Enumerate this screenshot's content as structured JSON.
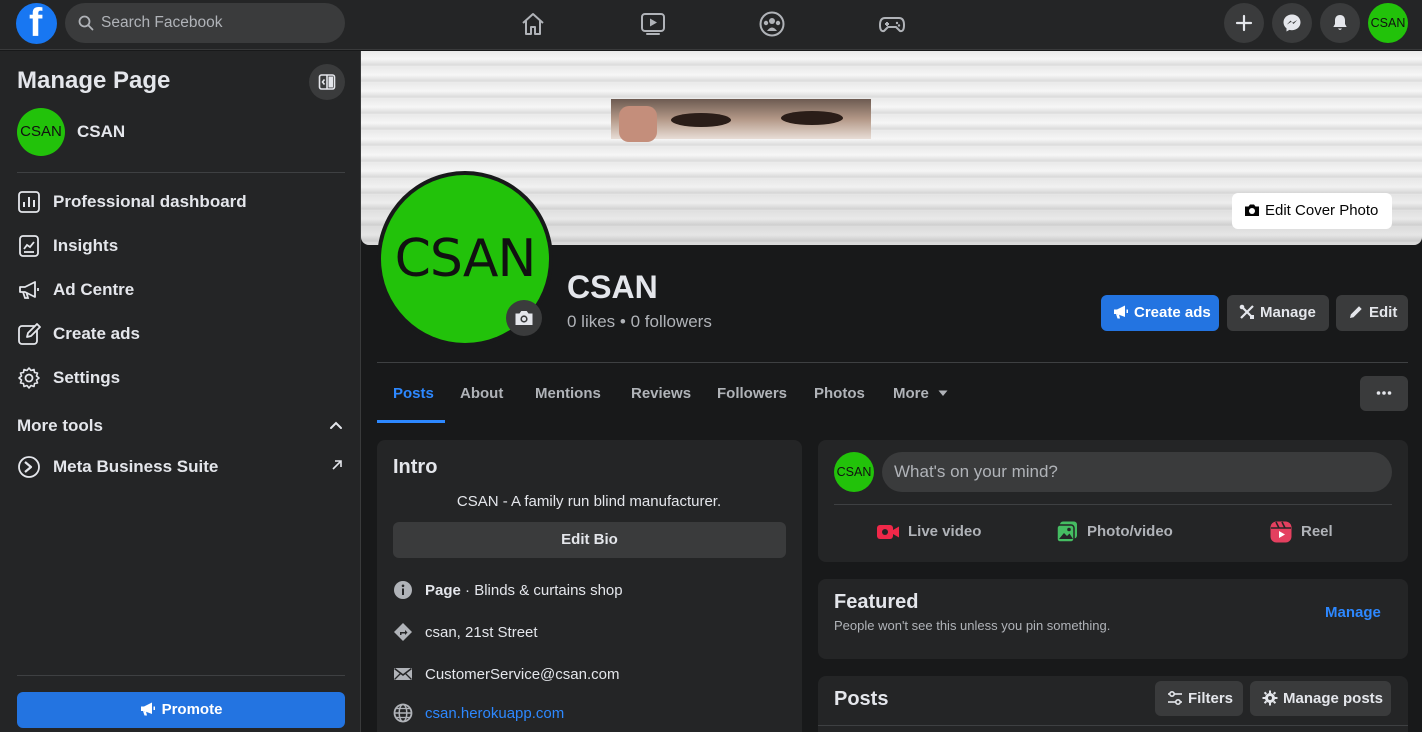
{
  "topbar": {
    "logo": "f",
    "search_placeholder": "Search Facebook",
    "nav_icons": [
      "home-icon",
      "watch-icon",
      "groups-icon",
      "gaming-icon"
    ],
    "right_icons": [
      "plus-icon",
      "messenger-icon",
      "notifications-icon"
    ],
    "avatar_text": "CSAN"
  },
  "sidebar": {
    "title": "Manage Page",
    "page_avatar": "CSAN",
    "page_name": "CSAN",
    "items": [
      {
        "label": "Professional dashboard",
        "icon": "dashboard-icon"
      },
      {
        "label": "Insights",
        "icon": "insights-icon"
      },
      {
        "label": "Ad Centre",
        "icon": "megaphone-icon"
      },
      {
        "label": "Create ads",
        "icon": "edit-icon"
      },
      {
        "label": "Settings",
        "icon": "gear-icon"
      }
    ],
    "more_tools": "More tools",
    "meta_suite": "Meta Business Suite",
    "promote": "Promote"
  },
  "header": {
    "edit_cover": "Edit Cover Photo",
    "profile_pic_text": "CSAN",
    "page_name": "CSAN",
    "stats": "0 likes • 0 followers",
    "create_ads": "Create ads",
    "manage": "Manage",
    "edit": "Edit"
  },
  "tabs": [
    {
      "label": "Posts",
      "active": true
    },
    {
      "label": "About"
    },
    {
      "label": "Mentions"
    },
    {
      "label": "Reviews"
    },
    {
      "label": "Followers"
    },
    {
      "label": "Photos"
    },
    {
      "label": "More"
    }
  ],
  "intro": {
    "title": "Intro",
    "bio": "CSAN - A family run blind manufacturer.",
    "edit_bio": "Edit Bio",
    "page_label": "Page",
    "category": " · Blinds & curtains shop",
    "address": "csan, 21st Street",
    "email": "CustomerService@csan.com",
    "website": "csan.herokuapp.com"
  },
  "composer": {
    "avatar_text": "CSAN",
    "placeholder": "What's on your mind?",
    "live": "Live video",
    "photo": "Photo/video",
    "reel": "Reel"
  },
  "featured": {
    "title": "Featured",
    "subtitle": "People won't see this unless you pin something.",
    "manage": "Manage"
  },
  "posts": {
    "title": "Posts",
    "filters": "Filters",
    "manage_posts": "Manage posts"
  },
  "colors": {
    "accent": "#2374e1",
    "link": "#2d88ff",
    "avatar_green": "#22c20a",
    "bg": "#18191a",
    "card": "#242526"
  }
}
